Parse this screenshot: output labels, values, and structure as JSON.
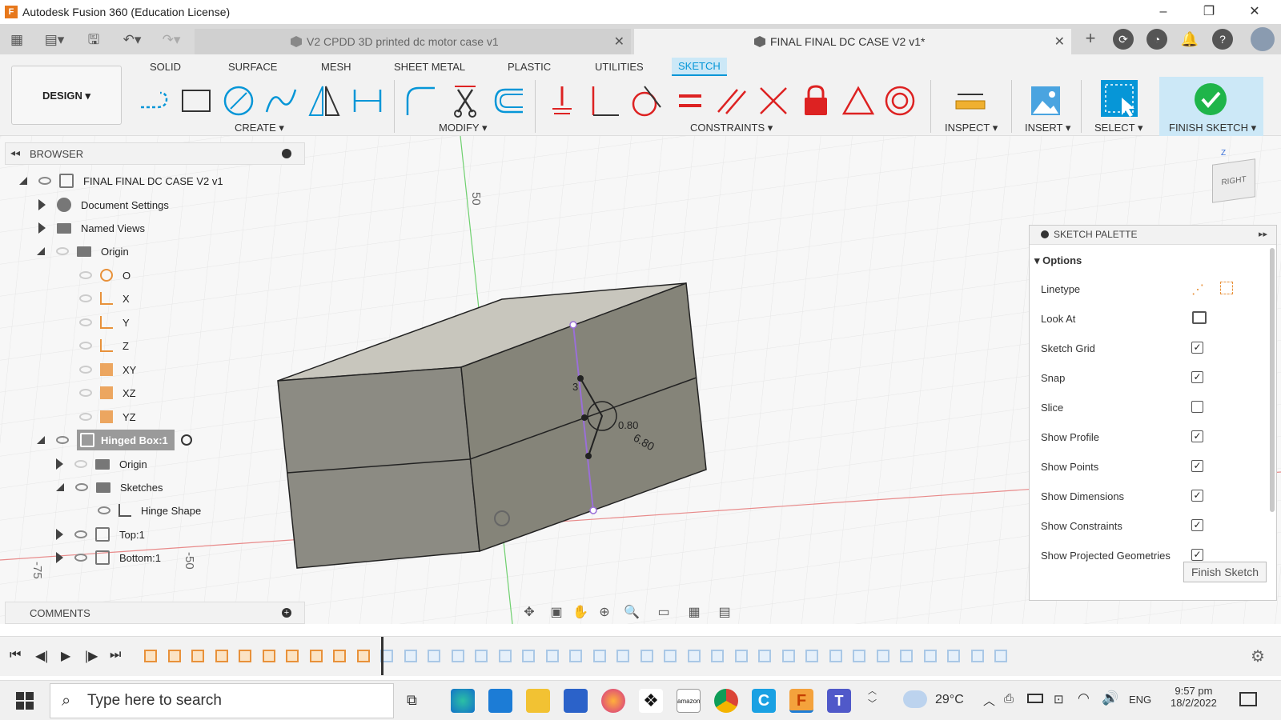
{
  "window": {
    "title": "Autodesk Fusion 360 (Education License)",
    "app_icon": "F"
  },
  "doc_tabs": [
    {
      "label": "V2 CPDD 3D printed dc motor case v1",
      "active": false
    },
    {
      "label": "FINAL FINAL DC CASE V2 v1*",
      "active": true
    }
  ],
  "ribbon": {
    "workspace": "DESIGN",
    "tabs": [
      "SOLID",
      "SURFACE",
      "MESH",
      "SHEET METAL",
      "PLASTIC",
      "UTILITIES",
      "SKETCH"
    ],
    "active_tab": "SKETCH",
    "groups": [
      "CREATE",
      "MODIFY",
      "CONSTRAINTS",
      "INSPECT",
      "INSERT",
      "SELECT",
      "FINISH SKETCH"
    ]
  },
  "browser": {
    "title": "BROWSER",
    "rows": [
      {
        "label": "FINAL FINAL DC CASE V2 v1"
      },
      {
        "label": "Document Settings"
      },
      {
        "label": "Named Views"
      },
      {
        "label": "Origin"
      },
      {
        "label": "O"
      },
      {
        "label": "X"
      },
      {
        "label": "Y"
      },
      {
        "label": "Z"
      },
      {
        "label": "XY"
      },
      {
        "label": "XZ"
      },
      {
        "label": "YZ"
      },
      {
        "label": "Hinged Box:1"
      },
      {
        "label": "Origin"
      },
      {
        "label": "Sketches"
      },
      {
        "label": "Hinge Shape"
      },
      {
        "label": "Top:1"
      },
      {
        "label": "Bottom:1"
      }
    ]
  },
  "comments": {
    "title": "COMMENTS"
  },
  "viewport": {
    "dim_top": "50",
    "dim_bottom": "-50",
    "dim_left": "-75",
    "viewcube_face": "RIGHT",
    "viewcube_axis": "Z",
    "sketch_dims": [
      "3",
      "0.80",
      "6.80"
    ]
  },
  "palette": {
    "title": "SKETCH PALETTE",
    "section": "Options",
    "options": [
      {
        "label": "Linetype",
        "checked": null
      },
      {
        "label": "Look At",
        "checked": null
      },
      {
        "label": "Sketch Grid",
        "checked": true
      },
      {
        "label": "Snap",
        "checked": true
      },
      {
        "label": "Slice",
        "checked": false
      },
      {
        "label": "Show Profile",
        "checked": true
      },
      {
        "label": "Show Points",
        "checked": true
      },
      {
        "label": "Show Dimensions",
        "checked": true
      },
      {
        "label": "Show Constraints",
        "checked": true
      },
      {
        "label": "Show Projected Geometries",
        "checked": true
      }
    ],
    "finish_button": "Finish Sketch"
  },
  "taskbar": {
    "search_placeholder": "Type here to search",
    "weather": "29°C",
    "lang": "ENG",
    "time": "9:57 pm",
    "date": "18/2/2022"
  },
  "colors": {
    "accent": "#0696d7",
    "finish_green": "#1fb54a",
    "model_face": "#8c8b83"
  }
}
